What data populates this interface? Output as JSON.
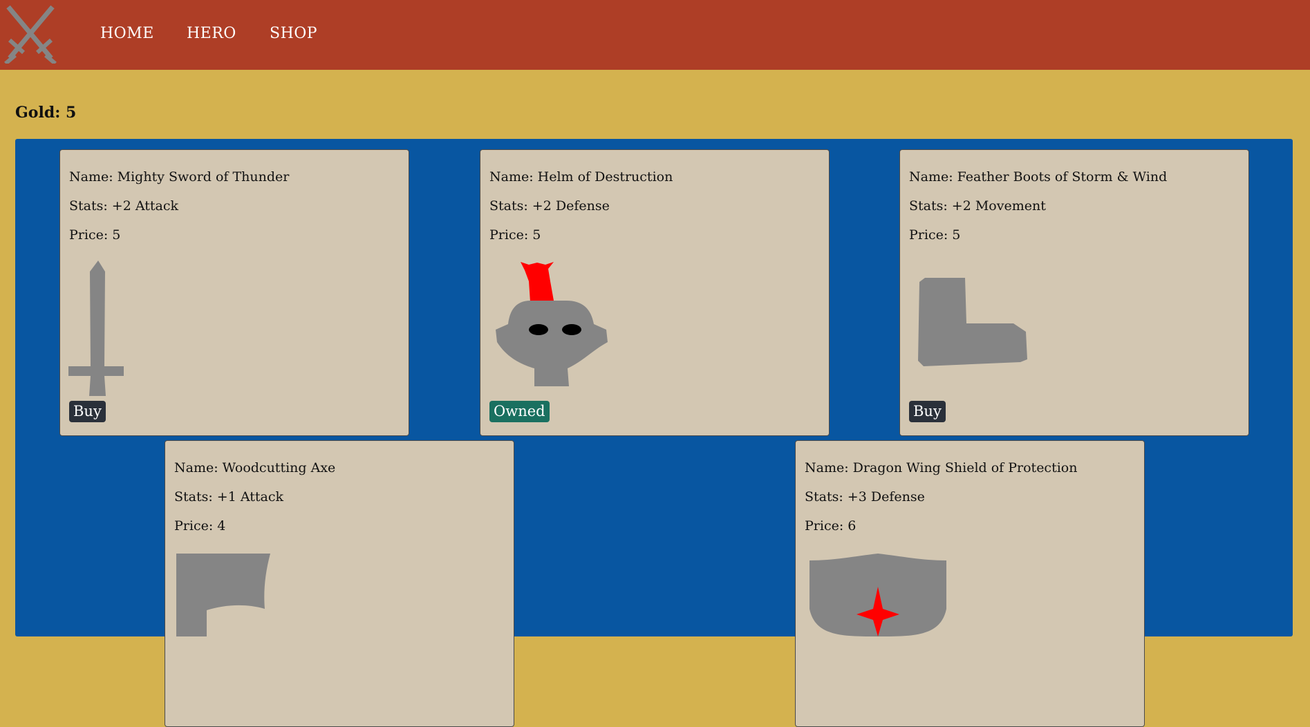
{
  "nav": {
    "links": [
      "HOME",
      "HERO",
      "SHOP"
    ],
    "logo_icon": "crossed-swords-icon"
  },
  "gold_label": "Gold: 5",
  "colors": {
    "navbar": "#ae3e26",
    "page_bg": "#d4b24f",
    "panel_bg": "#0856a1",
    "card_bg": "#d3c7b2",
    "buy_button": "#2a303a",
    "owned_button": "#1a7060",
    "item_gray": "#858585",
    "accent_red": "#ff0000"
  },
  "items": [
    {
      "name": "Name: Mighty Sword of Thunder",
      "stats": "Stats: +2 Attack",
      "price": "Price: 5",
      "button": "Buy",
      "icon": "sword-icon"
    },
    {
      "name": "Name: Helm of Destruction",
      "stats": "Stats: +2 Defense",
      "price": "Price: 5",
      "button": "Owned",
      "icon": "helmet-icon"
    },
    {
      "name": "Name: Feather Boots of Storm & Wind",
      "stats": "Stats: +2 Movement",
      "price": "Price: 5",
      "button": "Buy",
      "icon": "boot-icon"
    },
    {
      "name": "Name: Woodcutting Axe",
      "stats": "Stats: +1 Attack",
      "price": "Price: 4",
      "button": "",
      "icon": "axe-icon"
    },
    {
      "name": "Name: Dragon Wing Shield of Protection",
      "stats": "Stats: +3 Defense",
      "price": "Price: 6",
      "button": "",
      "icon": "shield-icon"
    }
  ]
}
